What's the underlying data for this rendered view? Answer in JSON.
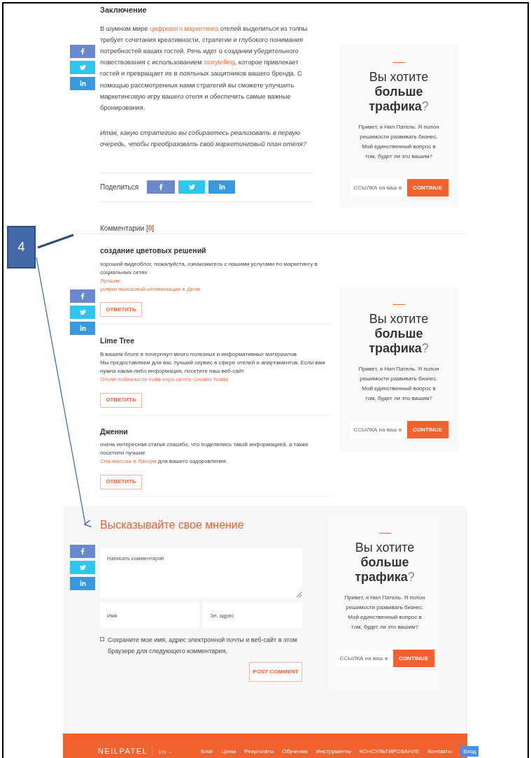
{
  "article": {
    "heading": "Заключение",
    "paragraph": [
      {
        "text": "В шумном мире "
      },
      {
        "text": "цифрового маркетинга",
        "link": true
      },
      {
        "text": " отелей выделиться из толпы требует сочетания креативности, стратегии и глубокого понимания потребностей ваших гостей. Речь идет о создании убедительного повествования с использованием "
      },
      {
        "text": "storytelling",
        "link": true
      },
      {
        "text": ", которое привлекает гостей и превращает их в лояльных защитников вашего бренда. С помощью рассмотренных нами стратегий вы сможете улучшить маркетинговую игру вашего отеля и обеспечить самые важные бронирования."
      }
    ],
    "question": "Итак, какую стратегию вы собираетесь реализовать в первую очередь, чтобы преобразовать свой маркетинговый план отеля?"
  },
  "share": {
    "label": "Поделиться"
  },
  "comments_heading": {
    "label": "Комментарии",
    "open_bracket": "[",
    "count": "0",
    "close_bracket": "]"
  },
  "comments": [
    {
      "author": "создание цветовых решений",
      "lines": [
        [
          {
            "text": "хороший видеоблог, пожалуйста, ознакомьтесь с нашими услугами по маркетингу в социальных сетях"
          }
        ],
        [
          {
            "text": "Лучшие",
            "link": true
          }
        ],
        [
          {
            "text": "услуги поисковой оптимизации в Дели",
            "link": true
          }
        ]
      ],
      "reply": "ОТВЕТИТЬ"
    },
    {
      "author": "Lime Tree",
      "lines": [
        [
          {
            "text": "В вашем блоге я почерпнул много полезных и информативных материалов"
          }
        ],
        [
          {
            "text": "Мы предоставляем для вас лучший сервис в сфере отелей и апартаментов. Если вам нужна какая-либо информация, посетите наш веб-сайт"
          }
        ],
        [
          {
            "text": "Отели поблизости india expo centre Greater Noida",
            "link": true
          }
        ]
      ],
      "reply": "ОТВЕТИТЬ"
    },
    {
      "author": "Дженни",
      "lines": [
        [
          {
            "text": "очень интересная статья спасибо, что поделились такой информацией, а также посетили лучшие"
          }
        ],
        [
          {
            "text": "Спа-массаж в Лахоре",
            "link": true
          },
          {
            "text": " для вашего оздоровления."
          }
        ]
      ],
      "reply": "ОТВЕТИТЬ"
    }
  ],
  "form": {
    "title": "Высказывайте свое мнение",
    "comment_placeholder": "Написать комментарий",
    "name_placeholder": "Имя",
    "email_placeholder": "Эл. адрес",
    "remember": {
      "label": "Сохраните мое имя, адрес электронной почты и веб-сайт в этом браузере для следующего комментария.",
      "checked": false
    },
    "submit": "POST COMMENT"
  },
  "cards": [
    {
      "title_start": "Вы хотите",
      "title_bold": "больше трафика",
      "title_end": "?",
      "text": "Привет, я Нил Патель. Я полон решимости развивать бизнес. Мой единственный вопрос в том, будет ли это вашим?",
      "input_placeholder": "ССЫЛКА на ваш в",
      "button": "CONTINUE"
    },
    {
      "title_start": "Вы хотите",
      "title_bold": "больше трафика",
      "title_end": "?",
      "text": "Привет, я Нил Патель. Я полон решимости развивать бизнес. Мой единственный вопрос в том, будет ли это вашим?",
      "input_placeholder": "ССЫЛКА на ваш в",
      "button": "CONTINUE"
    },
    {
      "title_start": "Вы хотите",
      "title_bold": "больше трафика",
      "title_end": "?",
      "text": "Привет, я Нил Патель. Я полон решимости развивать бизнес. Мой единственный вопрос в том, будет ли это вашим?",
      "input_placeholder": "ССЫЛКА на ваш в",
      "button": "CONTINUE"
    }
  ],
  "footer": {
    "logo": "NEILPATEL",
    "language": "EN",
    "nav": [
      "Блог",
      "Цены",
      "Результаты",
      "Обучение",
      "Инструменты",
      "КОНСУЛЬТИРОВАНИЕ",
      "Контакты"
    ],
    "login": "Вход"
  },
  "annotation": {
    "label": "4"
  }
}
